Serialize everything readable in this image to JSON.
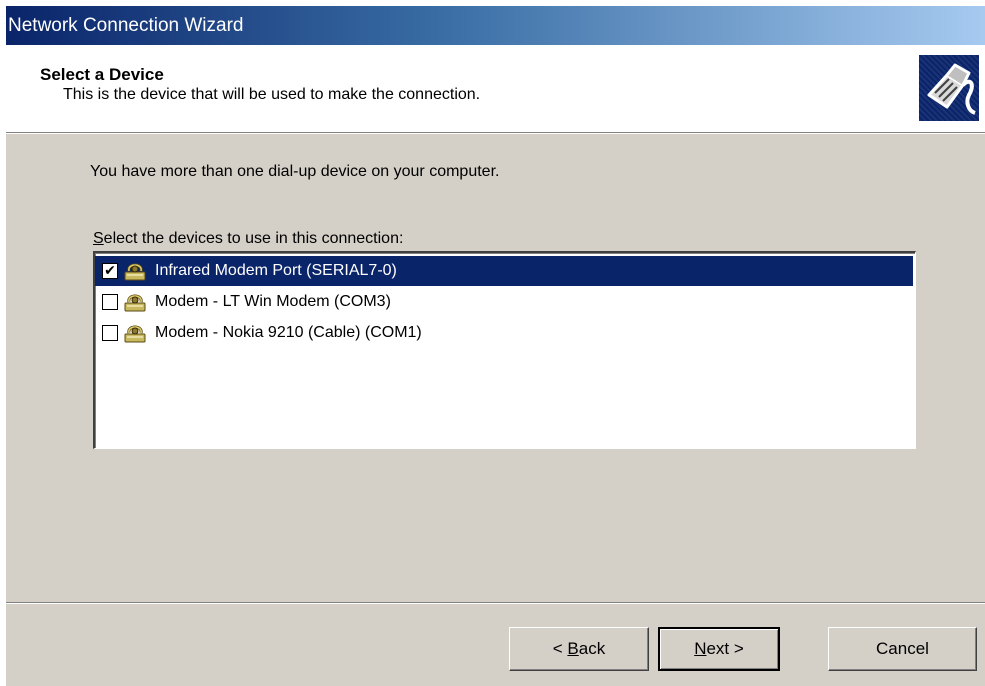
{
  "window": {
    "title": "Network Connection Wizard"
  },
  "header": {
    "title": "Select a Device",
    "subtitle": "This is the device that will be used to make the connection.",
    "icon": "network-cable-icon"
  },
  "body": {
    "intro": "You have more than one dial-up device on your computer.",
    "list_label_mnemonic": "S",
    "list_label_rest": "elect the devices to use in this connection:"
  },
  "devices": [
    {
      "label": "Infrared Modem Port (SERIAL7-0)",
      "checked": true,
      "selected": true,
      "icon": "modem-phone-icon"
    },
    {
      "label": "Modem - LT Win Modem (COM3)",
      "checked": false,
      "selected": false,
      "icon": "modem-phone-icon"
    },
    {
      "label": "Modem - Nokia 9210 (Cable) (COM1)",
      "checked": false,
      "selected": false,
      "icon": "modem-phone-icon"
    }
  ],
  "buttons": {
    "back_prefix": "< ",
    "back_mnemonic": "B",
    "back_rest": "ack",
    "next_mnemonic": "N",
    "next_rest": "ext >",
    "cancel": "Cancel"
  },
  "colors": {
    "selection": "#0a246a",
    "face": "#d4d0c8",
    "title_gradient_start": "#0a246a",
    "title_gradient_end": "#a6caf0"
  }
}
